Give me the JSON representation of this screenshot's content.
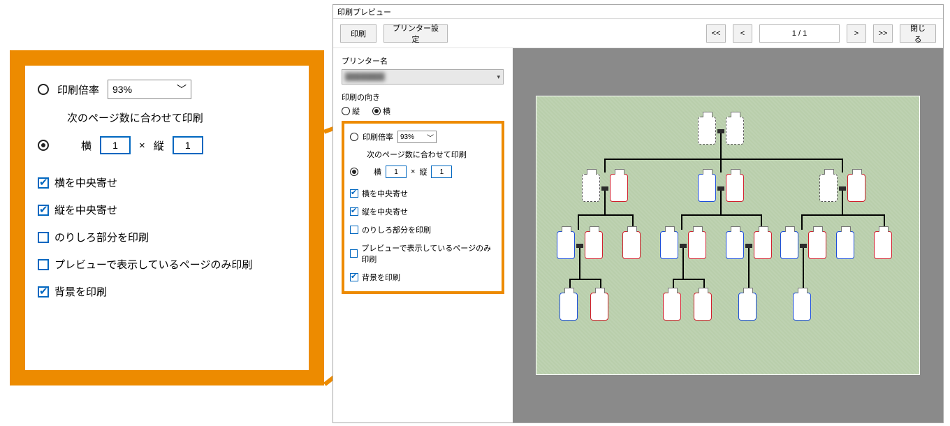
{
  "window": {
    "title": "印刷プレビュー",
    "print_btn": "印刷",
    "printer_settings_btn": "プリンター設定",
    "nav_first": "<<",
    "nav_prev": "<",
    "nav_next": ">",
    "nav_last": ">>",
    "page_counter": "1 / 1",
    "close_btn": "閉じる"
  },
  "sidebar": {
    "printer_name_label": "プリンター名",
    "printer_name_value": "████████",
    "orientation_label": "印刷の向き",
    "orient_portrait": "縦",
    "orient_landscape": "横",
    "orient_selected": "landscape"
  },
  "scale": {
    "ratio_label": "印刷倍率",
    "ratio_value": "93%",
    "fit_label": "次のページ数に合わせて印刷",
    "fit_h_label": "横",
    "fit_h_value": "1",
    "times": "×",
    "fit_v_label": "縦",
    "fit_v_value": "1",
    "mode": "fit"
  },
  "checks": {
    "center_h": {
      "label": "横を中央寄せ",
      "checked": true
    },
    "center_v": {
      "label": "縦を中央寄せ",
      "checked": true
    },
    "margins": {
      "label": "のりしろ部分を印刷",
      "checked": false
    },
    "visible_only": {
      "label": "プレビューで表示しているページのみ印刷",
      "checked": false
    },
    "background": {
      "label": "背景を印刷",
      "checked": true
    }
  }
}
